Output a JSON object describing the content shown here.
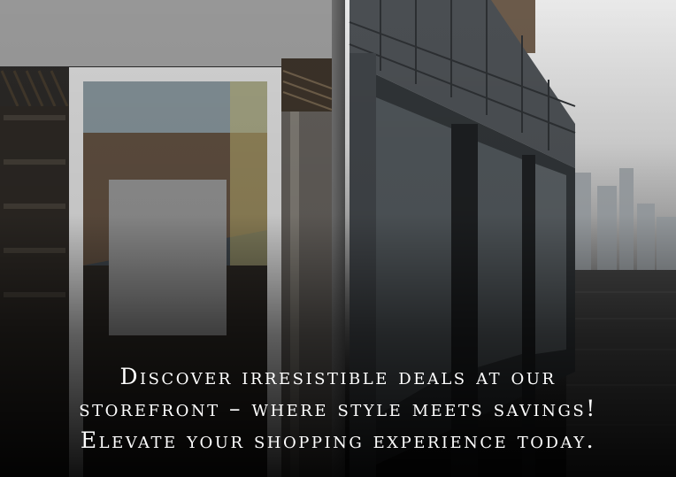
{
  "image": {
    "description_elements": [
      "storefront-photo-left",
      "storefront-photo-right"
    ]
  },
  "caption": {
    "line1": "Discover irresistible deals at our",
    "line2": "storefront – where style meets savings!",
    "line3": "Elevate your shopping experience today."
  },
  "colors": {
    "text": "#ffffff",
    "overlay": "#000000"
  }
}
